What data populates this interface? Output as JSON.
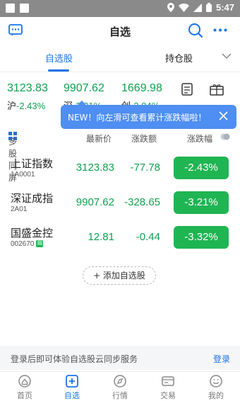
{
  "status": {
    "time": "5:47"
  },
  "header": {
    "title": "自选"
  },
  "tabs": [
    {
      "label": "自选股",
      "active": true
    },
    {
      "label": "持仓股",
      "active": false
    }
  ],
  "indices": [
    {
      "value": "3123.83",
      "exchange": "沪",
      "pct": "-2.43%"
    },
    {
      "value": "9907.62",
      "exchange": "深",
      "pct": "-3.21%"
    },
    {
      "value": "1669.98",
      "exchange": "创",
      "pct": "-3.84%"
    }
  ],
  "strip_icons": {
    "left": "calendar-icon",
    "right": "gift-icon"
  },
  "tooltip": {
    "text": "NEW！向左滑可查看累计涨跌幅啦！"
  },
  "table": {
    "multi_screen_label": "多股同屏",
    "columns": [
      "最新价",
      "涨跌额",
      "涨跌幅"
    ],
    "rows": [
      {
        "name": "上证指数",
        "code": "1A0001",
        "price": "3123.83",
        "change": "-77.78",
        "pct": "-2.43%"
      },
      {
        "name": "深证成指",
        "code": "2A01",
        "price": "9907.62",
        "change": "-328.65",
        "pct": "-3.21%"
      },
      {
        "name": "国盛金控",
        "code": "002670",
        "badge": "融",
        "price": "12.81",
        "change": "-0.44",
        "pct": "-3.32%"
      }
    ]
  },
  "add_button": {
    "label": "+ 添加自选股"
  },
  "login_bar": {
    "message": "登录后即可体验自选股云同步服务",
    "link": "登录"
  },
  "bottom_nav": [
    {
      "label": "首页",
      "icon": "home-icon",
      "active": false
    },
    {
      "label": "自选",
      "icon": "plus-square-icon",
      "active": true
    },
    {
      "label": "行情",
      "icon": "compass-icon",
      "active": false
    },
    {
      "label": "交易",
      "icon": "card-icon",
      "active": false
    },
    {
      "label": "我的",
      "icon": "smile-icon",
      "active": false
    }
  ],
  "colors": {
    "accent": "#1a73e8",
    "down": "#10a050",
    "badge": "#1fb552",
    "tooltip": "#4f8ef2"
  }
}
